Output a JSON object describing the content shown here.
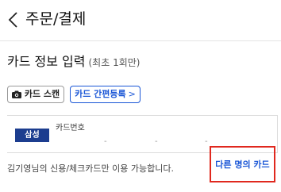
{
  "header": {
    "title": "주문/결제",
    "back_icon": "chevron-left-icon"
  },
  "card_input": {
    "title": "카드 정보 입력",
    "note": "(최초 1회만)",
    "scan_button_label": "카드 스캔",
    "scan_icon": "camera-icon",
    "register_button_label": "카드 간편등록",
    "register_chevron": ">",
    "card_brand": "삼성",
    "card_number_label": "카드번호",
    "card_number_separators": [
      "-",
      "-",
      "-"
    ]
  },
  "notice_text": "김기영님의 신용/체크카드만 이용 가능합니다.",
  "other_card_link": "다른 명의 카드",
  "colors": {
    "accent_blue": "#1a56d6",
    "card_brand_bg": "#1c3d8f",
    "highlight_red": "#e0281e"
  }
}
